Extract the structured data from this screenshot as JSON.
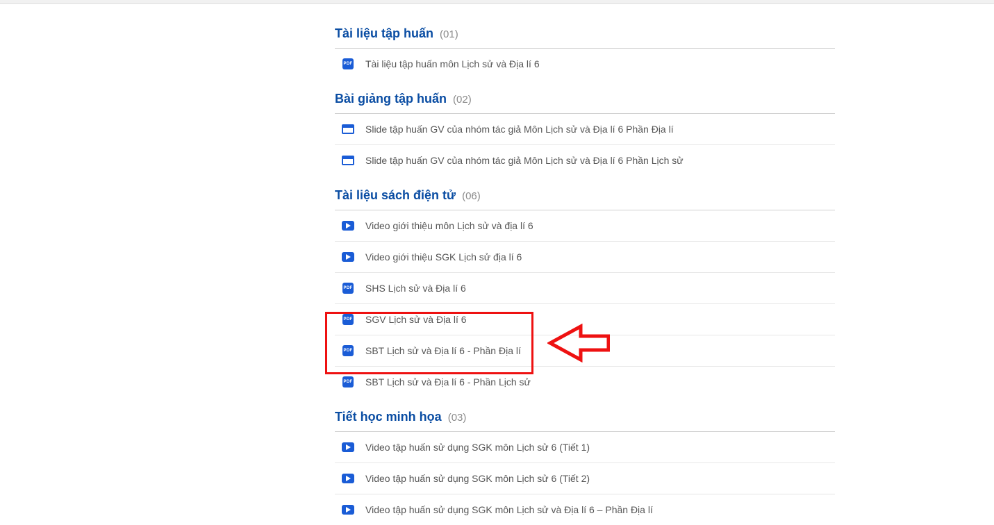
{
  "sections": [
    {
      "title": "Tài liệu tập huấn",
      "count": "(01)",
      "items": [
        {
          "icon": "pdf",
          "label": "Tài liệu tập huấn môn Lịch sử và Địa lí 6"
        }
      ]
    },
    {
      "title": "Bài giảng tập huấn",
      "count": "(02)",
      "items": [
        {
          "icon": "slide",
          "label": "Slide tập huấn GV của nhóm tác giả Môn Lịch sử và Địa lí 6 Phần Địa lí"
        },
        {
          "icon": "slide",
          "label": "Slide tập huấn GV của nhóm tác giả Môn Lịch sử và Địa lí 6 Phần Lịch sử"
        }
      ]
    },
    {
      "title": "Tài liệu sách điện tử",
      "count": "(06)",
      "items": [
        {
          "icon": "video",
          "label": "Video giới thiệu môn Lịch sử và địa lí 6"
        },
        {
          "icon": "video",
          "label": "Video giới thiệu SGK Lịch sử địa lí 6"
        },
        {
          "icon": "pdf",
          "label": "SHS Lịch sử và Địa lí 6"
        },
        {
          "icon": "pdf",
          "label": "SGV Lịch sử và Địa lí 6"
        },
        {
          "icon": "pdf",
          "label": "SBT Lịch sử và Địa lí 6 - Phần Địa lí"
        },
        {
          "icon": "pdf",
          "label": "SBT Lịch sử và Địa lí 6 - Phần Lịch sử"
        }
      ]
    },
    {
      "title": "Tiết học minh họa",
      "count": "(03)",
      "items": [
        {
          "icon": "video",
          "label": "Video tập huấn sử dụng SGK môn Lịch sử 6 (Tiết 1)"
        },
        {
          "icon": "video",
          "label": "Video tập huấn sử dụng SGK môn Lịch sử 6 (Tiết 2)"
        },
        {
          "icon": "video",
          "label": "Video tập huấn sử dụng SGK môn Lịch sử và Địa lí 6 – Phần Địa lí"
        }
      ]
    }
  ],
  "icon_text": {
    "pdf": "PDF"
  }
}
